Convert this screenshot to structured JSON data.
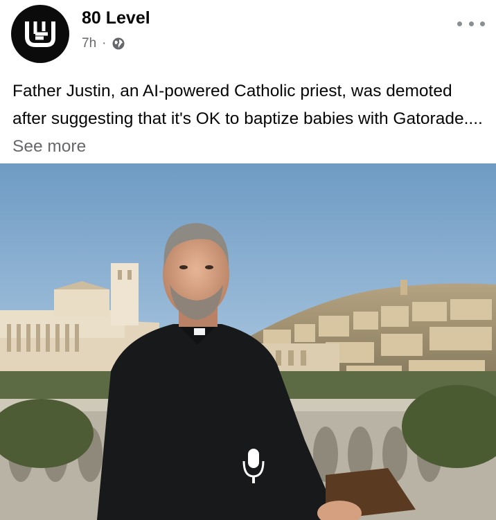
{
  "post": {
    "page_name": "80 Level",
    "time": "7h",
    "separator": "·",
    "privacy_icon": "globe-icon",
    "more_icon": "more-dots-icon",
    "text": "Father Justin, an AI-powered Catholic priest, was demoted after suggesting that it's OK to baptize babies with Gatorade....",
    "see_more_label": "See more"
  },
  "image": {
    "subject": "3D-rendered priest avatar seated in front of a hillside Italian town",
    "icons": [
      "microphone-icon"
    ]
  },
  "colors": {
    "text": "#050505",
    "secondary_text": "#65676b",
    "avatar_bg": "#0b0b0b",
    "sky": "#8fb3d4"
  }
}
